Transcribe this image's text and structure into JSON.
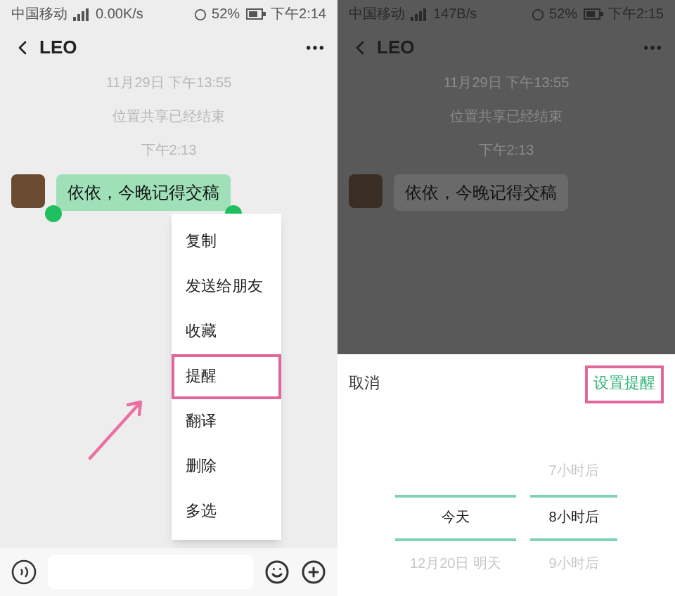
{
  "left_screen": {
    "status_bar": {
      "carrier": "中国移动",
      "speed": "0.00K/s",
      "battery": "52%",
      "time": "下午2:14"
    },
    "chat_title": "LEO",
    "notices": [
      "11月29日 下午13:55",
      "位置共享已经结束",
      "下午2:13"
    ],
    "message": {
      "text": "依依，今晚记得交稿",
      "selected": true
    },
    "context_menu": [
      {
        "label": "复制",
        "highlighted": false
      },
      {
        "label": "发送给朋友",
        "highlighted": false
      },
      {
        "label": "收藏",
        "highlighted": false
      },
      {
        "label": "提醒",
        "highlighted": true
      },
      {
        "label": "翻译",
        "highlighted": false
      },
      {
        "label": "删除",
        "highlighted": false
      },
      {
        "label": "多选",
        "highlighted": false
      }
    ]
  },
  "right_screen": {
    "status_bar": {
      "carrier": "中国移动",
      "speed": "147B/s",
      "battery": "52%",
      "time": "下午2:15"
    },
    "chat_title": "LEO",
    "notices": [
      "11月29日 下午13:55",
      "位置共享已经结束",
      "下午2:13"
    ],
    "message": {
      "text": "依依，今晚记得交稿",
      "selected": false
    },
    "sheet": {
      "cancel": "取消",
      "confirm": "设置提醒",
      "confirm_highlighted": true,
      "date_column": [
        {
          "text": "今天",
          "selected": true
        },
        {
          "text": "12月20日 明天",
          "selected": false
        }
      ],
      "hour_column": [
        {
          "text": "7小时后",
          "selected": false
        },
        {
          "text": "8小时后",
          "selected": true
        },
        {
          "text": "9小时后",
          "selected": false
        }
      ]
    }
  }
}
